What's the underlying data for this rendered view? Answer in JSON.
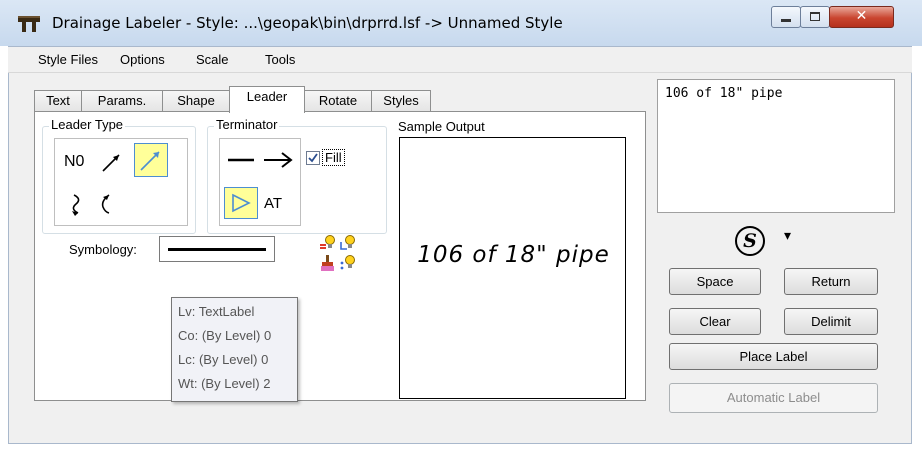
{
  "window": {
    "title": "Drainage Labeler - Style: ...\\geopak\\bin\\drprrd.lsf -> Unnamed Style",
    "min_glyph": "—",
    "max_glyph": "□",
    "close_glyph": "✕"
  },
  "menubar": {
    "items": [
      "Style Files",
      "Options",
      "Scale",
      "Tools"
    ]
  },
  "tabs": [
    "Text",
    "Params.",
    "Shape",
    "Leader",
    "Rotate",
    "Styles"
  ],
  "active_tab": "Leader",
  "leader_type": {
    "label": "Leader Type",
    "none_label": "N0"
  },
  "terminator": {
    "label": "Terminator",
    "fill_label": "Fill",
    "fill_checked": true,
    "at_label": "AT"
  },
  "symbology": {
    "label": "Symbology:"
  },
  "sample_output": {
    "label": "Sample Output",
    "text": "106 of 18\" pipe"
  },
  "tooltip": {
    "lines": [
      "Lv: TextLabel",
      "Co: (By Level) 0",
      "Lc: (By Level) 0",
      "Wt: (By Level) 2"
    ]
  },
  "preview": {
    "text": "106 of 18\" pipe"
  },
  "special_char": {
    "glyph": "S",
    "dropdown_glyph": "▾"
  },
  "buttons": {
    "space": "Space",
    "return": "Return",
    "clear": "Clear",
    "delimit": "Delimit",
    "place_label": "Place Label",
    "automatic_label": "Automatic Label"
  },
  "colors": {
    "yellow": "#ffff99",
    "accent_blue": "#4d8ed1",
    "close_red": "#c9452f"
  }
}
